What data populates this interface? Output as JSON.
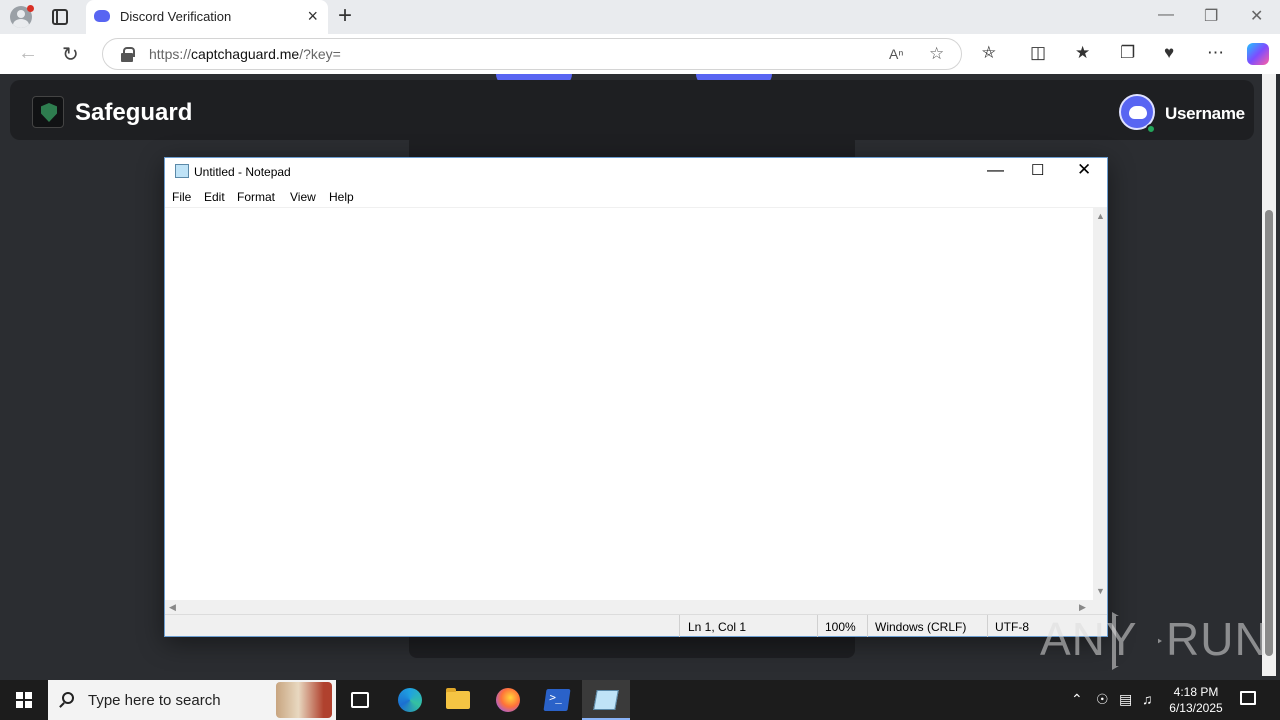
{
  "browser": {
    "tab_title": "Discord Verification",
    "url_scheme": "https://",
    "url_host": "captchaguard.me",
    "url_rest": "/?key=",
    "new_tab_symbol": "+",
    "close_symbol": "×"
  },
  "page": {
    "brand": "Safeguard",
    "username": "Username"
  },
  "notepad": {
    "title": "Untitled - Notepad",
    "menu": [
      "File",
      "Edit",
      "Format",
      "View",
      "Help"
    ],
    "status": {
      "position": "Ln 1, Col 1",
      "zoom": "100%",
      "line_ending": "Windows (CRLF)",
      "encoding": "UTF-8"
    }
  },
  "watermark": {
    "left": "ANY",
    "right": "RUN"
  },
  "taskbar": {
    "search_placeholder": "Type here to search",
    "time": "4:18 PM",
    "date": "6/13/2025"
  },
  "colors": {
    "discord_blurple": "#5865f2",
    "page_bg": "#2b2d31",
    "header_bg": "#1e1f22",
    "online": "#23a55a"
  }
}
